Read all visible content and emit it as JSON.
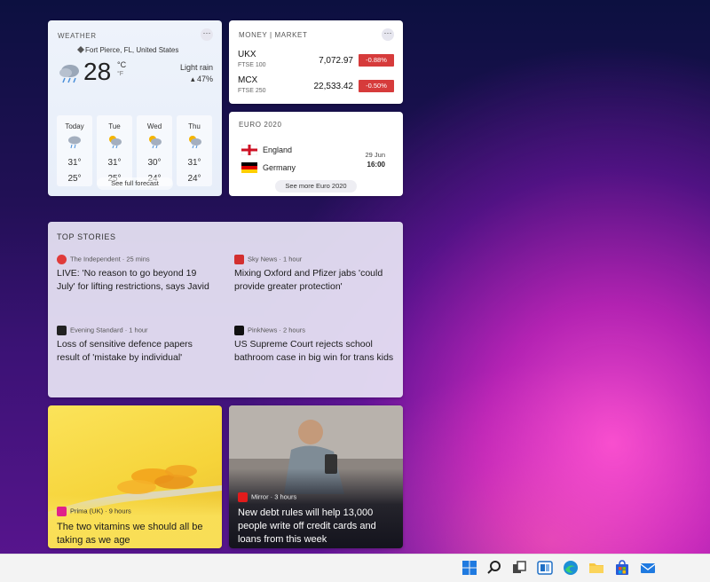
{
  "weather": {
    "title": "WEATHER",
    "location": "Fort Pierce, FL, United States",
    "temp": "28",
    "unit_c": "°C",
    "unit_f": "°F",
    "condition": "Light rain",
    "precip": "47%",
    "days": [
      {
        "name": "Today",
        "hi": "31°",
        "lo": "25°",
        "icon": "cloud-rain-icon"
      },
      {
        "name": "Tue",
        "hi": "31°",
        "lo": "25°",
        "icon": "sun-cloud-rain-icon"
      },
      {
        "name": "Wed",
        "hi": "30°",
        "lo": "24°",
        "icon": "sun-cloud-rain-icon"
      },
      {
        "name": "Thu",
        "hi": "31°",
        "lo": "24°",
        "icon": "sun-cloud-rain-icon"
      }
    ],
    "forecast_link": "See full forecast"
  },
  "money": {
    "title": "MONEY | MARKET",
    "tickers": [
      {
        "symbol": "UKX",
        "name": "FTSE 100",
        "price": "7,072.97",
        "change": "-0.88%"
      },
      {
        "symbol": "MCX",
        "name": "FTSE 250",
        "price": "22,533.42",
        "change": "-0.50%"
      }
    ],
    "change_color": "#d63b3b"
  },
  "euro": {
    "title": "EURO 2020",
    "team1": "England",
    "team2": "Germany",
    "date": "29 Jun",
    "time": "16:00",
    "more_link": "See more Euro 2020"
  },
  "stories": {
    "title": "TOP STORIES",
    "items": [
      {
        "source": "The Independent · 25 mins",
        "headline": "LIVE: 'No reason to go beyond 19 July' for lifting restrictions, says Javid"
      },
      {
        "source": "Sky News · 1 hour",
        "headline": "Mixing Oxford and Pfizer jabs 'could provide greater protection'"
      },
      {
        "source": "Evening Standard · 1 hour",
        "headline": "Loss of sensitive defence papers result of 'mistake by individual'"
      },
      {
        "source": "PinkNews · 2 hours",
        "headline": "US Supreme Court rejects school bathroom case in big win for trans kids"
      }
    ]
  },
  "cards": {
    "vitamins": {
      "source": "Prima (UK) · 9 hours",
      "headline": "The two vitamins we should all be taking as we age"
    },
    "debt": {
      "source": "Mirror · 3 hours",
      "headline": "New debt rules will help 13,000 people write off credit cards and loans from this week"
    }
  },
  "taskbar": {
    "icons": [
      "windows-start-icon",
      "search-icon",
      "task-view-icon",
      "widgets-icon",
      "edge-browser-icon",
      "file-explorer-icon",
      "store-icon",
      "mail-icon"
    ]
  }
}
